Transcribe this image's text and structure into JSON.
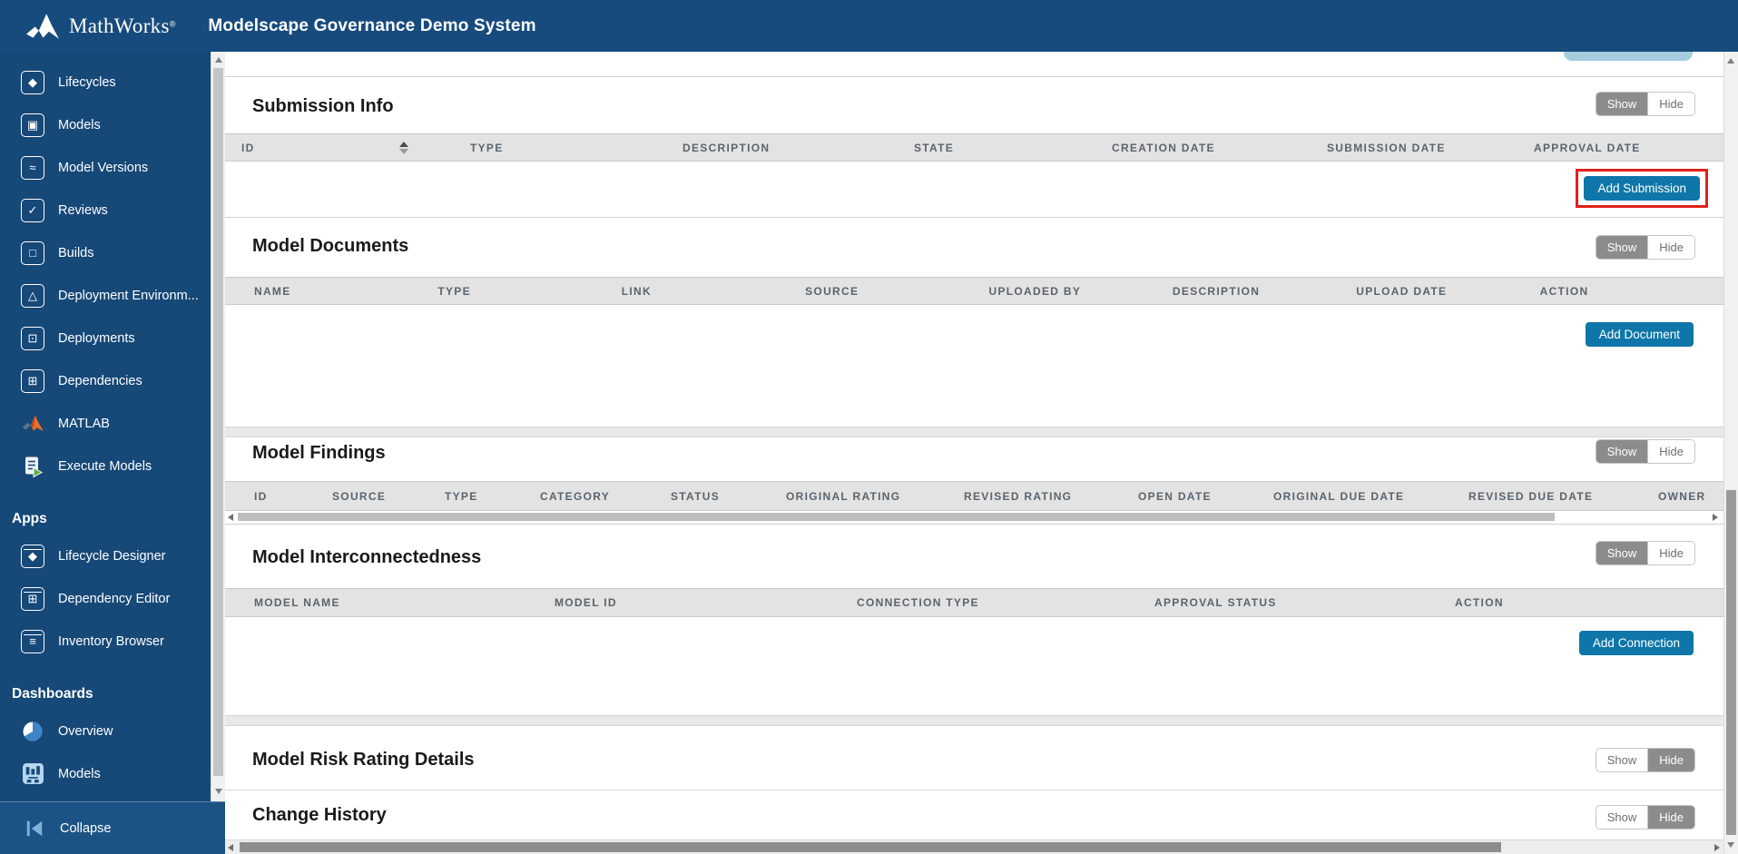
{
  "header": {
    "brand": "MathWorks",
    "registered": "®",
    "title": "Modelscape Governance Demo System"
  },
  "sidebar": {
    "nav": [
      {
        "label": "Lifecycles",
        "icon": "lifecycles-icon",
        "glyph": "◆"
      },
      {
        "label": "Models",
        "icon": "models-icon",
        "glyph": "▣"
      },
      {
        "label": "Model Versions",
        "icon": "model-versions-icon",
        "glyph": "≈"
      },
      {
        "label": "Reviews",
        "icon": "reviews-icon",
        "glyph": "✓"
      },
      {
        "label": "Builds",
        "icon": "builds-icon",
        "glyph": "□"
      },
      {
        "label": "Deployment Environm...",
        "icon": "deployment-environments-icon",
        "glyph": "△"
      },
      {
        "label": "Deployments",
        "icon": "deployments-icon",
        "glyph": "⊡"
      },
      {
        "label": "Dependencies",
        "icon": "dependencies-icon",
        "glyph": "⊞"
      },
      {
        "label": "MATLAB",
        "icon": "matlab-icon",
        "glyph": ""
      },
      {
        "label": "Execute Models",
        "icon": "execute-models-icon",
        "glyph": ""
      }
    ],
    "apps_title": "Apps",
    "apps": [
      {
        "label": "Lifecycle Designer",
        "icon": "lifecycle-designer-icon",
        "glyph": "◆"
      },
      {
        "label": "Dependency Editor",
        "icon": "dependency-editor-icon",
        "glyph": "⊞"
      },
      {
        "label": "Inventory Browser",
        "icon": "inventory-browser-icon",
        "glyph": "≡"
      }
    ],
    "dashboards_title": "Dashboards",
    "dashboards": [
      {
        "label": "Overview",
        "icon": "overview-pie-icon"
      },
      {
        "label": "Models",
        "icon": "models-dashboard-icon"
      }
    ],
    "collapse_label": "Collapse"
  },
  "toggle": {
    "show": "Show",
    "hide": "Hide"
  },
  "sections": [
    {
      "title": "Submission Info",
      "active": "show-active",
      "columns": [
        "ID",
        "TYPE",
        "DESCRIPTION",
        "STATE",
        "CREATION DATE",
        "SUBMISSION DATE",
        "APPROVAL DATE"
      ],
      "button": "Add Submission",
      "highlighted": "true"
    },
    {
      "title": "Model Documents",
      "active": "show-active",
      "columns": [
        "NAME",
        "TYPE",
        "LINK",
        "SOURCE",
        "UPLOADED BY",
        "DESCRIPTION",
        "UPLOAD DATE",
        "ACTION"
      ],
      "button": "Add Document"
    },
    {
      "title": "Model Findings",
      "active": "show-active",
      "columns": [
        "ID",
        "SOURCE",
        "TYPE",
        "CATEGORY",
        "STATUS",
        "ORIGINAL RATING",
        "REVISED RATING",
        "OPEN DATE",
        "ORIGINAL DUE DATE",
        "REVISED DUE DATE",
        "OWNER"
      ]
    },
    {
      "title": "Model Interconnectedness",
      "active": "show-active",
      "columns": [
        "MODEL NAME",
        "MODEL ID",
        "CONNECTION TYPE",
        "APPROVAL STATUS",
        "ACTION"
      ],
      "button": "Add Connection"
    },
    {
      "title": "Model Risk Rating Details",
      "active": "hide-active"
    },
    {
      "title": "Change History",
      "active": "hide-active"
    }
  ],
  "colors": {
    "header_navy": "#174B7D",
    "sidebar_navy": "#164878",
    "accent_teal": "#0E76A8",
    "highlight_red": "#E3201B",
    "table_header_bg": "#E3E3E3",
    "toggle_active_gray": "#8C8C8C",
    "partial_button_blue": "#A6CDDF"
  }
}
